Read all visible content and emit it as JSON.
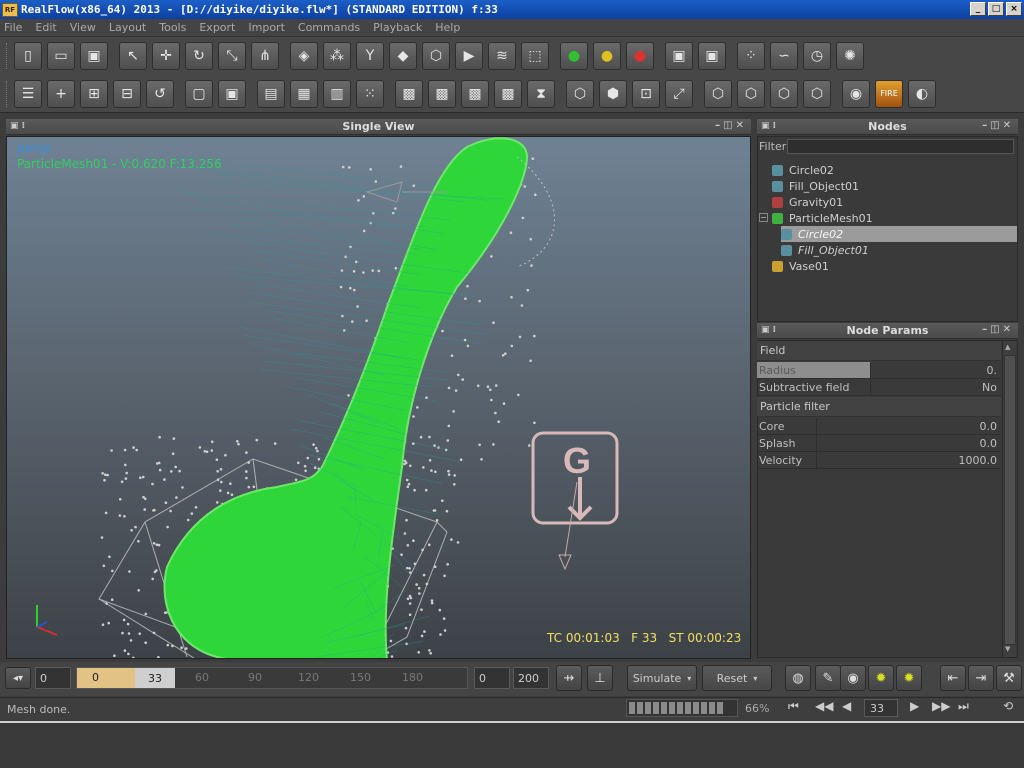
{
  "window": {
    "title": "RealFlow(x86_64) 2013 - [D://diyike/diyike.flw*] (STANDARD EDITION) f:33",
    "app_icon": "RF",
    "buttons": {
      "minimize": "_",
      "maximize": "□",
      "close": "×"
    }
  },
  "menu": [
    "File",
    "Edit",
    "View",
    "Layout",
    "Tools",
    "Export",
    "Import",
    "Commands",
    "Playback",
    "Help"
  ],
  "toolbar1": [
    {
      "name": "new-scene-icon",
      "glyph": "▯"
    },
    {
      "name": "open-icon",
      "glyph": "▭"
    },
    {
      "name": "save-icon",
      "glyph": "▣"
    },
    {
      "name": "select-icon",
      "glyph": "↖"
    },
    {
      "name": "move-icon",
      "glyph": "✛"
    },
    {
      "name": "rotate-icon",
      "glyph": "↻"
    },
    {
      "name": "scale-icon",
      "glyph": "⤡"
    },
    {
      "name": "axis-icon",
      "glyph": "⋔"
    },
    {
      "name": "object-icon",
      "glyph": "◈"
    },
    {
      "name": "particles-icon",
      "glyph": "⁂"
    },
    {
      "name": "daemon-icon",
      "glyph": "Y"
    },
    {
      "name": "mesh-icon",
      "glyph": "◆"
    },
    {
      "name": "rigid-body-icon",
      "glyph": "⬡"
    },
    {
      "name": "camera-icon",
      "glyph": "▶"
    },
    {
      "name": "wave-icon",
      "glyph": "≋"
    },
    {
      "name": "cube-icon",
      "glyph": "⬚"
    },
    {
      "name": "green-light-icon",
      "glyph": "●"
    },
    {
      "name": "yellow-light-icon",
      "glyph": "●"
    },
    {
      "name": "red-light-icon",
      "glyph": "●"
    },
    {
      "name": "save-green-icon",
      "glyph": "▣"
    },
    {
      "name": "save-red-icon",
      "glyph": "▣"
    },
    {
      "name": "batch-icon",
      "glyph": "⁘"
    },
    {
      "name": "graph-icon",
      "glyph": "∽"
    },
    {
      "name": "clock-icon",
      "glyph": "◷"
    },
    {
      "name": "brain-icon",
      "glyph": "✺"
    }
  ],
  "toolbar2": [
    {
      "name": "list-icon",
      "glyph": "☰"
    },
    {
      "name": "add-icon",
      "glyph": "+"
    },
    {
      "name": "link-icon",
      "glyph": "⊞"
    },
    {
      "name": "unlink-icon",
      "glyph": "⊟"
    },
    {
      "name": "refresh-icon",
      "glyph": "↺"
    },
    {
      "name": "box-icon",
      "glyph": "▢"
    },
    {
      "name": "box-filled-icon",
      "glyph": "▣"
    },
    {
      "name": "script-icon",
      "glyph": "▤"
    },
    {
      "name": "grid-icon",
      "glyph": "▦"
    },
    {
      "name": "batch-script-icon",
      "glyph": "▥"
    },
    {
      "name": "cells-icon",
      "glyph": "⁙"
    },
    {
      "name": "frame-a-icon",
      "glyph": "▩"
    },
    {
      "name": "frame-b-icon",
      "glyph": "▩"
    },
    {
      "name": "frame-c-icon",
      "glyph": "▩"
    },
    {
      "name": "frame-d-icon",
      "glyph": "▩"
    },
    {
      "name": "hourglass-icon",
      "glyph": "⧗"
    },
    {
      "name": "cage-a-icon",
      "glyph": "⬡"
    },
    {
      "name": "cage-b-icon",
      "glyph": "⬢"
    },
    {
      "name": "viewport-icon",
      "glyph": "⊡"
    },
    {
      "name": "expand-icon",
      "glyph": "⤢"
    },
    {
      "name": "cube-a-icon",
      "glyph": "⬡"
    },
    {
      "name": "cube-b-icon",
      "glyph": "⬡"
    },
    {
      "name": "cube-c-icon",
      "glyph": "⬡"
    },
    {
      "name": "cube-d-icon",
      "glyph": "⬡"
    },
    {
      "name": "render-icon",
      "glyph": "◉"
    },
    {
      "name": "fire-icon",
      "glyph": "FIRE"
    },
    {
      "name": "preview-icon",
      "glyph": "◐"
    }
  ],
  "viewport": {
    "title": "Single View",
    "camera": "persp",
    "info": "ParticleMesh01 - V:0.620 F:13.256",
    "status": "TC 00:01:03   F 33   ST 00:00:23",
    "gravity_label": "G"
  },
  "nodes": {
    "title": "Nodes",
    "filter_label": "Filter",
    "filter_value": "",
    "items": [
      {
        "label": "Circle02",
        "color": "#5a8fa0",
        "level": 0,
        "selected": false
      },
      {
        "label": "Fill_Object01",
        "color": "#5a8fa0",
        "level": 0,
        "selected": false
      },
      {
        "label": "Gravity01",
        "color": "#b04040",
        "level": 0,
        "selected": false
      },
      {
        "label": "ParticleMesh01",
        "color": "#40b040",
        "level": 0,
        "selected": false
      },
      {
        "label": "Circle02",
        "color": "#5a8fa0",
        "level": 1,
        "selected": true
      },
      {
        "label": "Fill_Object01",
        "color": "#5a8fa0",
        "level": 1,
        "selected": false
      },
      {
        "label": "Vase01",
        "color": "#c8a030",
        "level": 0,
        "selected": false
      }
    ]
  },
  "params": {
    "title": "Node Params",
    "sections": [
      {
        "label": "Field"
      },
      {
        "label": "Particle filter"
      }
    ],
    "field_rows": [
      {
        "label": "Radius",
        "value": "0."
      },
      {
        "label": "Subtractive field",
        "value": "No"
      }
    ],
    "filter_rows": [
      {
        "label": "Core",
        "value": "0.0"
      },
      {
        "label": "Splash",
        "value": "0.0"
      },
      {
        "label": "Velocity",
        "value": "1000.0"
      }
    ]
  },
  "timeline": {
    "start": "0",
    "current": "33",
    "ticks": [
      "0",
      "60",
      "90",
      "120",
      "150",
      "180"
    ],
    "range_start": "0",
    "range_end": "200",
    "simulate": "Simulate",
    "reset": "Reset",
    "range_fill": 0.165
  },
  "status": {
    "message": "Mesh done.",
    "progress_pct": "66%",
    "frame": "33"
  }
}
